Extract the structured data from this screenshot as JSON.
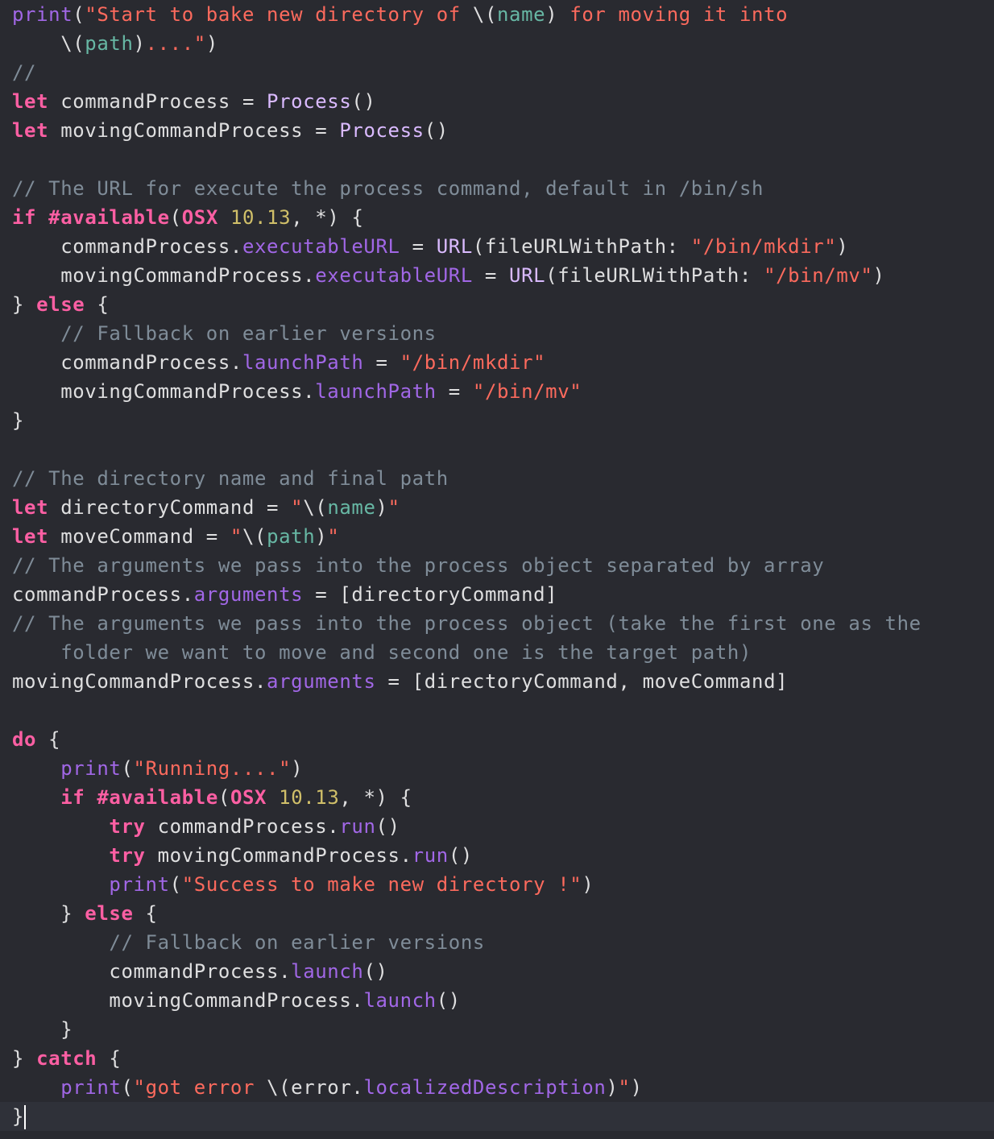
{
  "editor": {
    "language": "swift",
    "current_line": 39,
    "colors": {
      "background": "#292a30",
      "plain": "#dfdfe0",
      "keyword": "#fc5fa3",
      "string": "#fc6a5d",
      "comment": "#7f8c98",
      "number": "#d0bf69",
      "function": "#a167e6",
      "type": "#dabaff",
      "interpolation": "#67b7a4",
      "current_line": "#2f3139"
    },
    "lines": [
      [
        [
          "fn",
          "print"
        ],
        [
          "plain",
          "("
        ],
        [
          "str",
          "\"Start to bake new directory of "
        ],
        [
          "plain",
          "\\("
        ],
        [
          "interp",
          "name"
        ],
        [
          "plain",
          ")"
        ],
        [
          "str",
          " for moving it into"
        ]
      ],
      [
        [
          "plain",
          "    \\("
        ],
        [
          "interp",
          "path"
        ],
        [
          "plain",
          ")"
        ],
        [
          "str",
          "....\""
        ],
        [
          "plain",
          ")"
        ]
      ],
      [
        [
          "cmt",
          "//"
        ]
      ],
      [
        [
          "kw",
          "let"
        ],
        [
          "plain",
          " commandProcess = "
        ],
        [
          "type",
          "Process"
        ],
        [
          "plain",
          "()"
        ]
      ],
      [
        [
          "kw",
          "let"
        ],
        [
          "plain",
          " movingCommandProcess = "
        ],
        [
          "type",
          "Process"
        ],
        [
          "plain",
          "()"
        ]
      ],
      [],
      [
        [
          "cmt",
          "// The URL for execute the process command, default in /bin/sh"
        ]
      ],
      [
        [
          "kw",
          "if"
        ],
        [
          "plain",
          " "
        ],
        [
          "kw",
          "#available"
        ],
        [
          "plain",
          "("
        ],
        [
          "kw",
          "OSX"
        ],
        [
          "plain",
          " "
        ],
        [
          "num",
          "10.13"
        ],
        [
          "plain",
          ", *) {"
        ]
      ],
      [
        [
          "plain",
          "    commandProcess."
        ],
        [
          "fn",
          "executableURL"
        ],
        [
          "plain",
          " = "
        ],
        [
          "type",
          "URL"
        ],
        [
          "plain",
          "(fileURLWithPath: "
        ],
        [
          "str",
          "\"/bin/mkdir\""
        ],
        [
          "plain",
          ")"
        ]
      ],
      [
        [
          "plain",
          "    movingCommandProcess."
        ],
        [
          "fn",
          "executableURL"
        ],
        [
          "plain",
          " = "
        ],
        [
          "type",
          "URL"
        ],
        [
          "plain",
          "(fileURLWithPath: "
        ],
        [
          "str",
          "\"/bin/mv\""
        ],
        [
          "plain",
          ")"
        ]
      ],
      [
        [
          "plain",
          "} "
        ],
        [
          "kw",
          "else"
        ],
        [
          "plain",
          " {"
        ]
      ],
      [
        [
          "cmt",
          "    // Fallback on earlier versions"
        ]
      ],
      [
        [
          "plain",
          "    commandProcess."
        ],
        [
          "fn",
          "launchPath"
        ],
        [
          "plain",
          " = "
        ],
        [
          "str",
          "\"/bin/mkdir\""
        ]
      ],
      [
        [
          "plain",
          "    movingCommandProcess."
        ],
        [
          "fn",
          "launchPath"
        ],
        [
          "plain",
          " = "
        ],
        [
          "str",
          "\"/bin/mv\""
        ]
      ],
      [
        [
          "plain",
          "}"
        ]
      ],
      [],
      [
        [
          "cmt",
          "// The directory name and final path"
        ]
      ],
      [
        [
          "kw",
          "let"
        ],
        [
          "plain",
          " directoryCommand = "
        ],
        [
          "str",
          "\""
        ],
        [
          "plain",
          "\\("
        ],
        [
          "interp",
          "name"
        ],
        [
          "plain",
          ")"
        ],
        [
          "str",
          "\""
        ]
      ],
      [
        [
          "kw",
          "let"
        ],
        [
          "plain",
          " moveCommand = "
        ],
        [
          "str",
          "\""
        ],
        [
          "plain",
          "\\("
        ],
        [
          "interp",
          "path"
        ],
        [
          "plain",
          ")"
        ],
        [
          "str",
          "\""
        ]
      ],
      [
        [
          "cmt",
          "// The arguments we pass into the process object separated by array"
        ]
      ],
      [
        [
          "plain",
          "commandProcess."
        ],
        [
          "fn",
          "arguments"
        ],
        [
          "plain",
          " = [directoryCommand]"
        ]
      ],
      [
        [
          "cmt",
          "// The arguments we pass into the process object (take the first one as the"
        ]
      ],
      [
        [
          "cmt",
          "    folder we want to move and second one is the target path)"
        ]
      ],
      [
        [
          "plain",
          "movingCommandProcess."
        ],
        [
          "fn",
          "arguments"
        ],
        [
          "plain",
          " = [directoryCommand, moveCommand]"
        ]
      ],
      [],
      [
        [
          "kw",
          "do"
        ],
        [
          "plain",
          " {"
        ]
      ],
      [
        [
          "plain",
          "    "
        ],
        [
          "fn",
          "print"
        ],
        [
          "plain",
          "("
        ],
        [
          "str",
          "\"Running....\""
        ],
        [
          "plain",
          ")"
        ]
      ],
      [
        [
          "plain",
          "    "
        ],
        [
          "kw",
          "if"
        ],
        [
          "plain",
          " "
        ],
        [
          "kw",
          "#available"
        ],
        [
          "plain",
          "("
        ],
        [
          "kw",
          "OSX"
        ],
        [
          "plain",
          " "
        ],
        [
          "num",
          "10.13"
        ],
        [
          "plain",
          ", *) {"
        ]
      ],
      [
        [
          "plain",
          "        "
        ],
        [
          "kw",
          "try"
        ],
        [
          "plain",
          " commandProcess."
        ],
        [
          "fn",
          "run"
        ],
        [
          "plain",
          "()"
        ]
      ],
      [
        [
          "plain",
          "        "
        ],
        [
          "kw",
          "try"
        ],
        [
          "plain",
          " movingCommandProcess."
        ],
        [
          "fn",
          "run"
        ],
        [
          "plain",
          "()"
        ]
      ],
      [
        [
          "plain",
          "        "
        ],
        [
          "fn",
          "print"
        ],
        [
          "plain",
          "("
        ],
        [
          "str",
          "\"Success to make new directory !\""
        ],
        [
          "plain",
          ")"
        ]
      ],
      [
        [
          "plain",
          "    } "
        ],
        [
          "kw",
          "else"
        ],
        [
          "plain",
          " {"
        ]
      ],
      [
        [
          "cmt",
          "        // Fallback on earlier versions"
        ]
      ],
      [
        [
          "plain",
          "        commandProcess."
        ],
        [
          "fn",
          "launch"
        ],
        [
          "plain",
          "()"
        ]
      ],
      [
        [
          "plain",
          "        movingCommandProcess."
        ],
        [
          "fn",
          "launch"
        ],
        [
          "plain",
          "()"
        ]
      ],
      [
        [
          "plain",
          "    }"
        ]
      ],
      [
        [
          "plain",
          "} "
        ],
        [
          "kw",
          "catch"
        ],
        [
          "plain",
          " {"
        ]
      ],
      [
        [
          "plain",
          "    "
        ],
        [
          "fn",
          "print"
        ],
        [
          "plain",
          "("
        ],
        [
          "str",
          "\"got error "
        ],
        [
          "plain",
          "\\(error."
        ],
        [
          "fn",
          "localizedDescription"
        ],
        [
          "plain",
          ")"
        ],
        [
          "str",
          "\""
        ],
        [
          "plain",
          ")"
        ]
      ],
      [
        [
          "plain",
          "}"
        ]
      ]
    ]
  }
}
